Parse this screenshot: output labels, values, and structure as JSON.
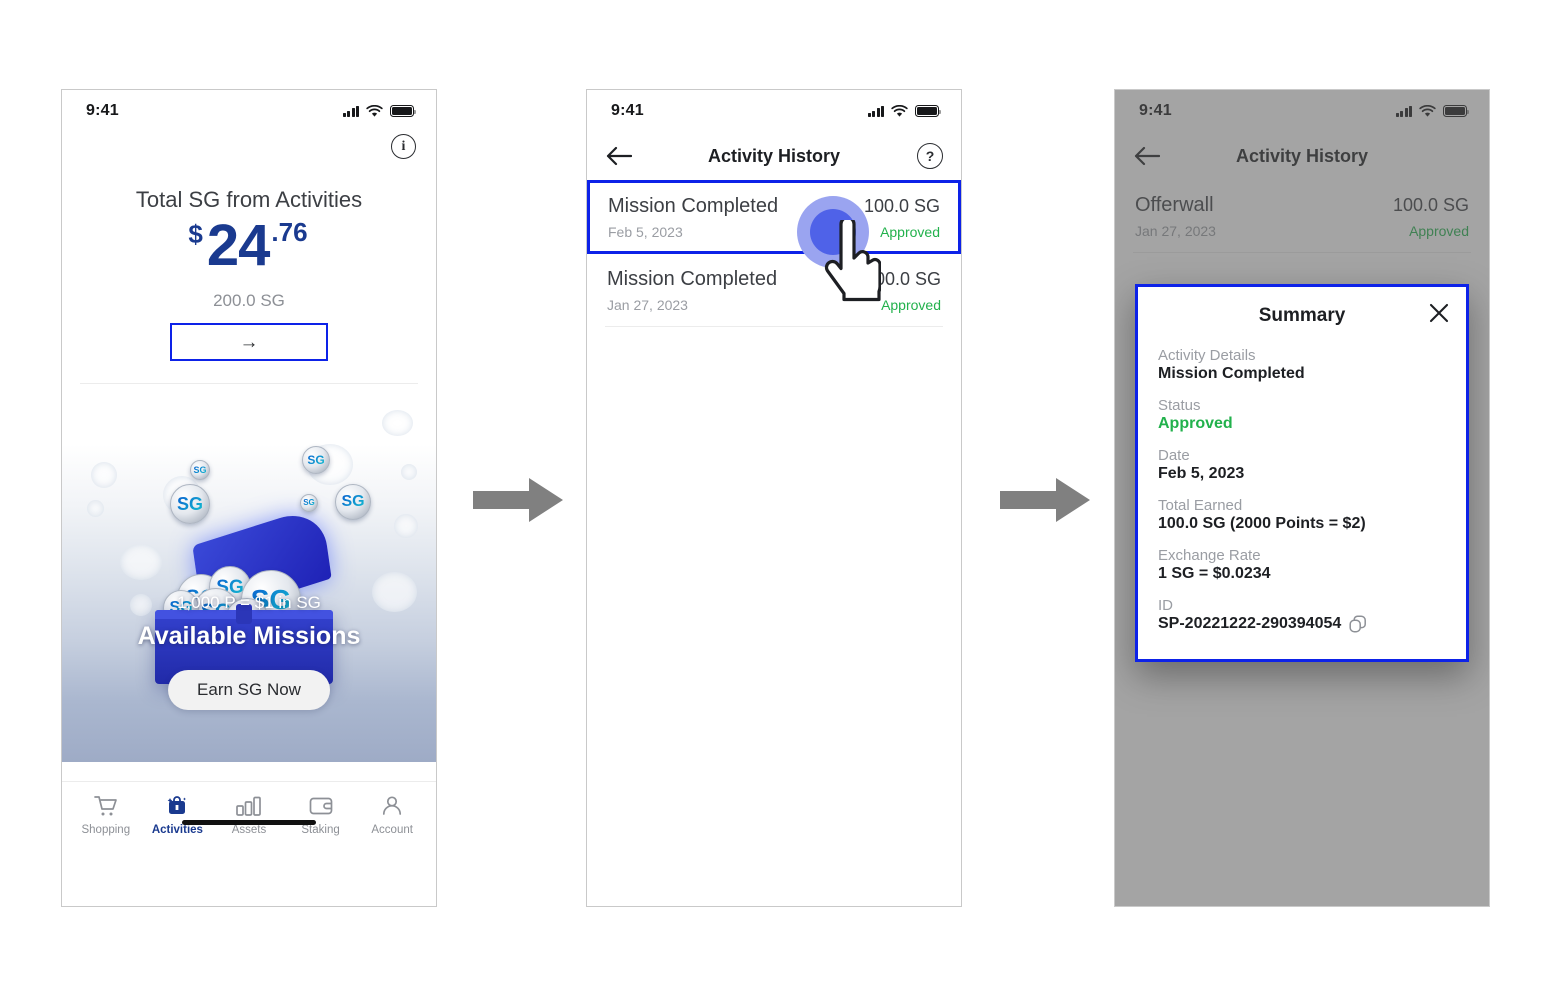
{
  "statusbar": {
    "time": "9:41"
  },
  "colors": {
    "brand_blue": "#1a3a8f",
    "highlight_blue": "#0d22e8",
    "approved_green": "#22b14c",
    "muted_gray": "#9a9da3"
  },
  "screen1": {
    "info_icon": "info-icon",
    "title": "Total SG from Activities",
    "amount_dollar": "$",
    "amount_whole": "24",
    "amount_cents": ".76",
    "sg_balance": "200.0 SG",
    "arrow_button_glyph": "→",
    "banner": {
      "subtitle": "1,000 P = $1 in SG",
      "title": "Available Missions",
      "cta": "Earn SG Now"
    },
    "tabs": [
      {
        "label": "Shopping",
        "icon": "cart-icon",
        "active": false
      },
      {
        "label": "Activities",
        "icon": "activities-icon",
        "active": true
      },
      {
        "label": "Assets",
        "icon": "bars-icon",
        "active": false
      },
      {
        "label": "Staking",
        "icon": "wallet-icon",
        "active": false
      },
      {
        "label": "Account",
        "icon": "person-icon",
        "active": false
      }
    ]
  },
  "screen2": {
    "nav": {
      "back_icon": "back-arrow-icon",
      "title": "Activity History",
      "help_icon": "help-icon"
    },
    "rows": [
      {
        "title": "Mission Completed",
        "date": "Feb 5, 2023",
        "amount": "100.0 SG",
        "status": "Approved",
        "highlighted": true
      },
      {
        "title": "Mission Completed",
        "date": "Jan 27, 2023",
        "amount": "100.0 SG",
        "status": "Approved",
        "highlighted": false
      }
    ]
  },
  "screen3": {
    "nav": {
      "back_icon": "back-arrow-icon",
      "title": "Activity History"
    },
    "rows": [
      {
        "title": "Offerwall",
        "date": "Jan 27, 2023",
        "amount": "100.0 SG",
        "status": "Approved"
      }
    ],
    "modal": {
      "title": "Summary",
      "close_icon": "close-icon",
      "fields": [
        {
          "label": "Activity Details",
          "value": "Mission Completed",
          "green": false,
          "copy": false
        },
        {
          "label": "Status",
          "value": "Approved",
          "green": true,
          "copy": false
        },
        {
          "label": "Date",
          "value": "Feb 5, 2023",
          "green": false,
          "copy": false
        },
        {
          "label": "Total Earned",
          "value": "100.0 SG (2000 Points = $2)",
          "green": false,
          "copy": false
        },
        {
          "label": "Exchange Rate",
          "value": "1 SG = $0.0234",
          "green": false,
          "copy": false
        },
        {
          "label": "ID",
          "value": "SP-20221222-290394054",
          "green": false,
          "copy": true
        }
      ]
    }
  },
  "connectors": [
    {
      "name": "flow-arrow-1"
    },
    {
      "name": "flow-arrow-2"
    }
  ]
}
